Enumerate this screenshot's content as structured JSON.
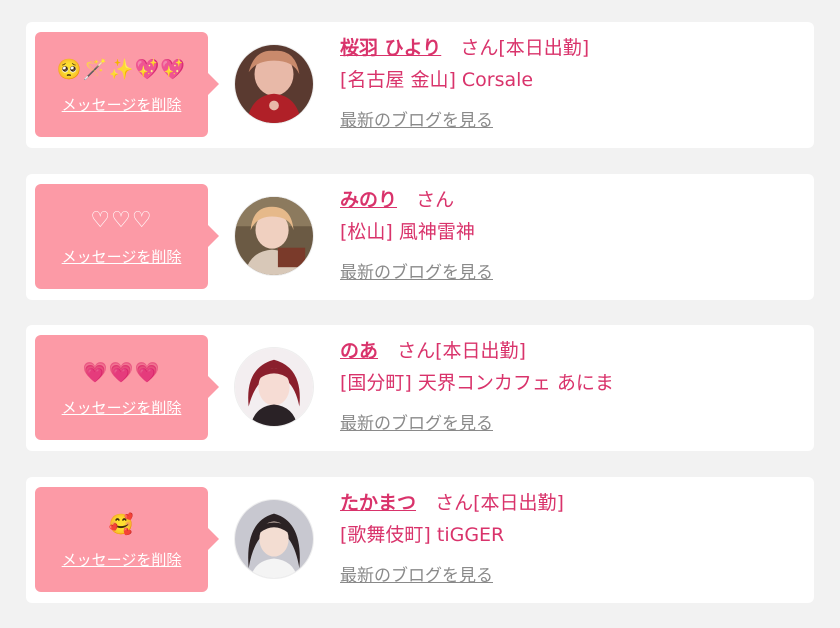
{
  "cards": [
    {
      "message": "🥺🪄✨💖💖",
      "delete_label": "メッセージを削除",
      "name": "桜羽 ひより",
      "suffix": "さん[本日出勤]",
      "shop": "[名古屋 金山] Corsale",
      "blog_label": "最新のブログを見る"
    },
    {
      "message": "♡♡♡",
      "delete_label": "メッセージを削除",
      "name": "みのり",
      "suffix": "さん",
      "shop": "[松山] 風神雷神",
      "blog_label": "最新のブログを見る"
    },
    {
      "message": "💗💗💗",
      "delete_label": "メッセージを削除",
      "name": "のあ",
      "suffix": "さん[本日出勤]",
      "shop": "[国分町] 天界コンカフェ あにま",
      "blog_label": "最新のブログを見る"
    },
    {
      "message": "🥰",
      "delete_label": "メッセージを削除",
      "name": "たかまつ",
      "suffix": "さん[本日出勤]",
      "shop": "[歌舞伎町] tiGGER",
      "blog_label": "最新のブログを見る"
    }
  ],
  "colors": {
    "background": "#f2f2f2",
    "card": "#ffffff",
    "bubble": "#fc9aa6",
    "name_pink": "#d9336b",
    "link_gray": "#8a8a8a"
  }
}
